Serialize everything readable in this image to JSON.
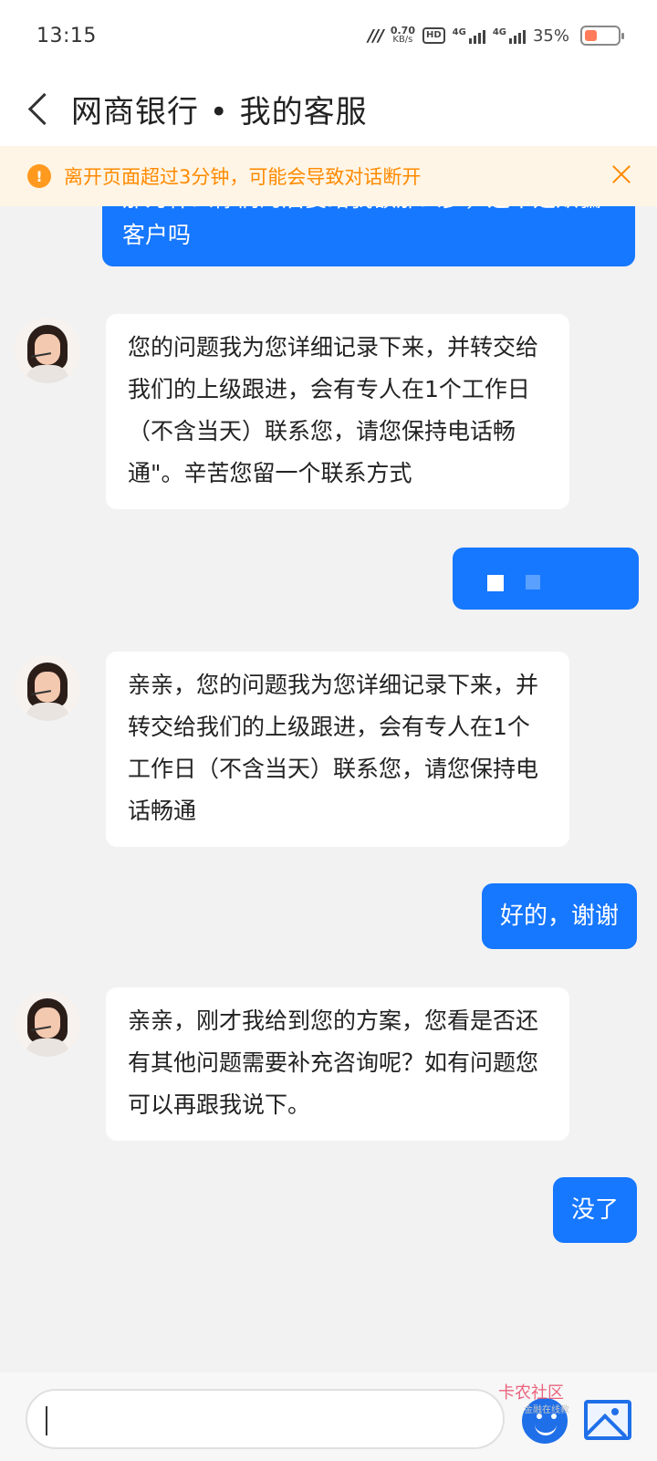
{
  "status_bar": {
    "time": "13:15",
    "network_speed_value": "0.70",
    "network_speed_unit": "KB/s",
    "hd_label": "HD",
    "signal_label_1": "4G",
    "signal_label_2": "4G",
    "battery_percent": "35%",
    "battery_level": 0.35,
    "battery_color": "#ff7b5a"
  },
  "header": {
    "title": "网商银行 • 我的客服"
  },
  "banner": {
    "text": "离开页面超过3分钟，可能会导致对话断开",
    "warn_symbol": "!",
    "color": "#ff8a00"
  },
  "chat": {
    "accent": "#1677ff",
    "messages": [
      {
        "from": "user",
        "text": "那为什么你们的后要给我额那么多，这不是欺骗客户吗"
      },
      {
        "from": "agent",
        "text": "您的问题我为您详细记录下来，并转交给我们的上级跟进，会有专人在1个工作日（不含当天）联系您，请您保持电话畅通\"。辛苦您留一个联系方式"
      },
      {
        "from": "user",
        "text": ""
      },
      {
        "from": "agent",
        "text": "亲亲，您的问题我为您详细记录下来，并转交给我们的上级跟进，会有专人在1个工作日（不含当天）联系您，请您保持电话畅通"
      },
      {
        "from": "user",
        "text": "好的，谢谢"
      },
      {
        "from": "agent",
        "text": "亲亲，刚才我给到您的方案，您看是否还有其他问题需要补充咨询呢？如有问题您可以再跟我说下。"
      },
      {
        "from": "user",
        "text": "没了"
      }
    ]
  },
  "input_bar": {
    "placeholder": "",
    "emoji_icon": "emoji-icon",
    "image_icon": "image-icon",
    "watermark": "卡农社区",
    "watermark_sub": "金融在线教"
  }
}
